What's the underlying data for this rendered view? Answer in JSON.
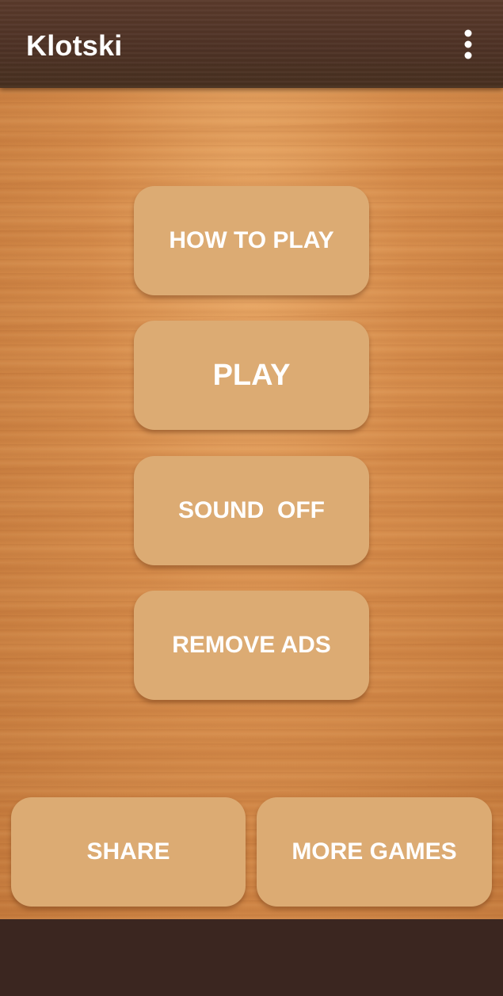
{
  "app_bar": {
    "title": "Klotski",
    "menu_icon": "more-vert-icon"
  },
  "menu": {
    "how_to_play": "HOW TO PLAY",
    "play": "PLAY",
    "sound": "SOUND  OFF",
    "remove_ads": "REMOVE ADS"
  },
  "bottom_buttons": {
    "share": "SHARE",
    "more_games": "MORE GAMES"
  },
  "colors": {
    "button": "#dcab73",
    "app_bar": "#4e3225",
    "bottom_bar": "#3b2620",
    "text": "#ffffff"
  }
}
